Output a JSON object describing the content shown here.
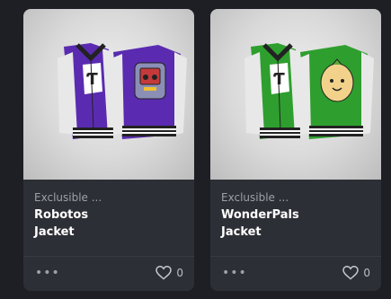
{
  "items": [
    {
      "creator": "Exclusible ...",
      "name_line1": "Robotos",
      "name_line2": "Jacket",
      "favorites": "0",
      "body_color": "#5a2bb0",
      "patch_bg": "#5a2bb0"
    },
    {
      "creator": "Exclusible ...",
      "name_line1": "WonderPals",
      "name_line2": "Jacket",
      "favorites": "0",
      "body_color": "#2e9f2e",
      "patch_bg": "#2e9f2e"
    }
  ],
  "icons": {
    "more": "more-options-icon",
    "favorite": "heart-icon"
  },
  "more_glyph": "•••"
}
